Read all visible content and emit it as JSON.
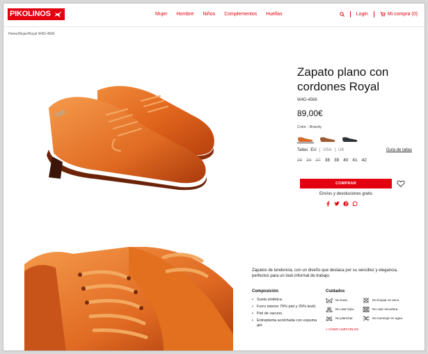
{
  "brand": {
    "logo_text": "PIKOLINOS"
  },
  "nav": {
    "items": [
      "Mujer",
      "Hombre",
      "Niños",
      "Complementos",
      "Huellas"
    ]
  },
  "user_nav": {
    "login": "Login",
    "cart": "Mi compra (0)"
  },
  "breadcrumb": "Home/Mujer/Royal W4D-4566",
  "product": {
    "title": "Zapato plano con cordones Royal",
    "reference": "W4D-4566",
    "price": "89,00€",
    "color_label": "Color : Brandy",
    "swatch_colors": [
      "#d4692a",
      "#9b5a33",
      "#2e3238"
    ],
    "sizes_label": "Tallas",
    "size_units": [
      "EU",
      "USA",
      "UK"
    ],
    "size_guide": "Guía de tallas",
    "sizes": [
      {
        "label": "35",
        "available": false
      },
      {
        "label": "36",
        "available": false
      },
      {
        "label": "37",
        "available": false
      },
      {
        "label": "38",
        "available": true
      },
      {
        "label": "39",
        "available": true
      },
      {
        "label": "40",
        "available": true
      },
      {
        "label": "41",
        "available": true
      },
      {
        "label": "42",
        "available": true
      }
    ],
    "buy_label": "COMPRAR",
    "shipping": "Envíos y devoluciones gratis"
  },
  "details": {
    "description": "Zapatos de tendencia, con un diseño que destaca por su sencillez y elegancia, perfectos para un look informal de trabajo.",
    "composition_title": "Composición",
    "composition": [
      "Suela sintética.",
      "Forro interior 75% piel y 25% textil.",
      "Piel de vacuno.",
      "Entreplanta acolchada con espuma gel."
    ],
    "care_title": "Cuidados",
    "care": [
      "No lavar.",
      "No limpiar en seco.",
      "No usar lejía.",
      "No usar secadora.",
      "No planchar.",
      "No sumergir en agua."
    ],
    "care_link": "> CÓMO LIMPIARLOS"
  },
  "colors": {
    "brand_red": "#e3000f"
  }
}
